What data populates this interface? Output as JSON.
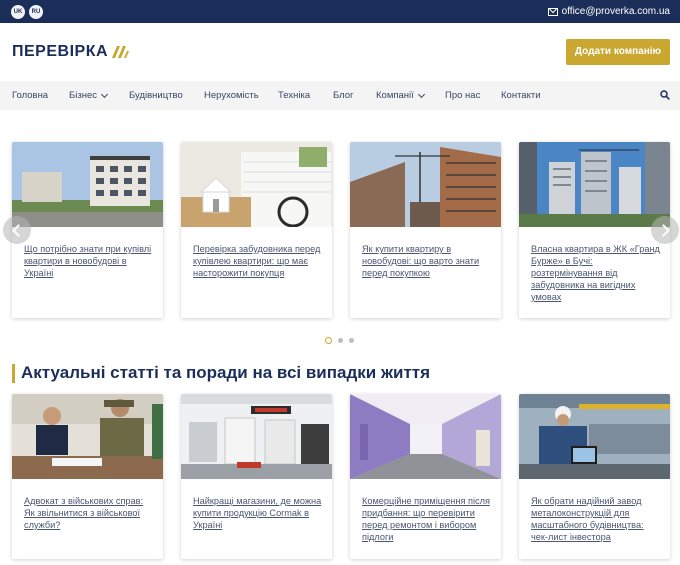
{
  "topbar": {
    "languages": [
      "UK",
      "RU"
    ],
    "email": "office@proverka.com.ua"
  },
  "header": {
    "logo_text": "ПЕРЕВІРКА",
    "cta_label": "Додати компанію"
  },
  "nav": {
    "items": [
      {
        "label": "Головна",
        "dropdown": false
      },
      {
        "label": "Бізнес",
        "dropdown": true
      },
      {
        "label": "Будівництво",
        "dropdown": false
      },
      {
        "label": "Нерухомість",
        "dropdown": false
      },
      {
        "label": "Техніка",
        "dropdown": false
      },
      {
        "label": "Блог",
        "dropdown": false
      },
      {
        "label": "Компанії",
        "dropdown": true
      },
      {
        "label": "Про нас",
        "dropdown": false
      },
      {
        "label": "Контакти",
        "dropdown": false
      }
    ],
    "search_icon": "search-icon"
  },
  "slider": {
    "cards": [
      {
        "title": "Що потрібно знати при купівлі квартири в новобудові в Україні"
      },
      {
        "title": "Перевірка забудовника перед купівлею квартири: що має насторожити покупця"
      },
      {
        "title": "Як купити квартиру в новобудові: що варто знати перед покупкою"
      },
      {
        "title": "Власна квартира в ЖК «Гранд Бурже» в Бучі: розтермінування від забудовника на вигідних умовах"
      }
    ],
    "active_dot": 1,
    "dot_count": 3
  },
  "articles": {
    "section_title": "Актуальні статті та поради на всі випадки життя",
    "cards": [
      {
        "title": "Адвокат з військових справ: Як звільнитися з військової служби?"
      },
      {
        "title": "Найкращі магазини, де можна купити продукцію Cormak в Україні"
      },
      {
        "title": "Комерційне приміщення після придбання: що перевірити перед ремонтом і вибором підлоги"
      },
      {
        "title": "Як обрати надійний завод металоконструкцій для масштабного будівництва: чек-лист інвестора"
      }
    ]
  },
  "colors": {
    "navy": "#1b2e5a",
    "gold": "#c9a731",
    "nav_bg": "#f4f4f4"
  }
}
